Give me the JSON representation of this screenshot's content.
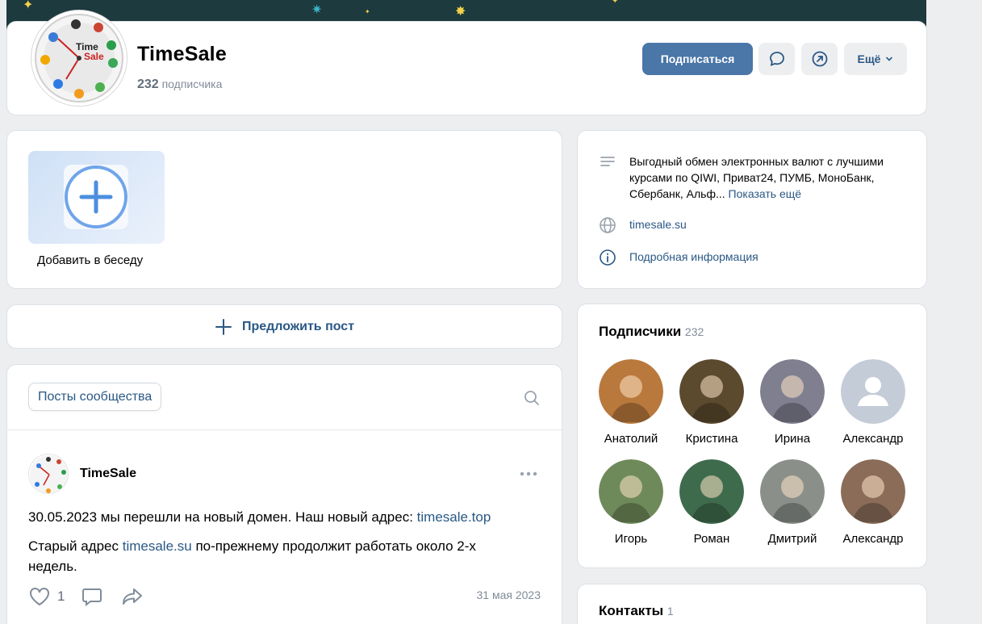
{
  "group": {
    "name": "TimeSale",
    "subscribers_count": "232",
    "subscribers_word": "подписчика",
    "logo_text_1": "Time",
    "logo_text_2": "Sale"
  },
  "actions": {
    "subscribe": "Подписаться",
    "more": "Ещё"
  },
  "chat": {
    "add_label": "Добавить в беседу"
  },
  "info": {
    "description": "Выгодный обмен электронных валют с лучшими курсами по QIWI, Приват24, ПУМБ, МоноБанк, Сбербанк, Альф...",
    "show_more": "Показать ещё",
    "website": "timesale.su",
    "details": "Подробная информация"
  },
  "suggest": {
    "label": "Предложить пост"
  },
  "posts": {
    "tab": "Посты сообщества",
    "post": {
      "author": "TimeSale",
      "line1_prefix": "30.05.2023 мы перешли на новый домен. Наш новый адрес: ",
      "line1_link": "timesale.top",
      "line2_prefix": "Старый адрес ",
      "line2_link": "timesale.su",
      "line2_suffix": " по-прежнему продолжит работать около 2-х",
      "line3": "недель.",
      "likes": "1",
      "date": "31 мая 2023"
    }
  },
  "subscribers": {
    "title": "Подписчики",
    "count": "232",
    "people": [
      {
        "name": "Анатолий",
        "color": "#b9793d"
      },
      {
        "name": "Кристина",
        "color": "#5b4a2e"
      },
      {
        "name": "Ирина",
        "color": "#7f7f8f"
      },
      {
        "name": "Александр",
        "color": "#c4ccd8"
      },
      {
        "name": "Игорь",
        "color": "#6f8a5a"
      },
      {
        "name": "Роман",
        "color": "#3f6b4d"
      },
      {
        "name": "Дмитрий",
        "color": "#8a8f8a"
      },
      {
        "name": "Александр",
        "color": "#8a6c58"
      }
    ]
  },
  "contacts": {
    "title": "Контакты",
    "count": "1"
  },
  "colors": {
    "primary": "#4a76a8",
    "link": "#2a5885",
    "muted": "#818c99",
    "background": "#edeef0"
  }
}
